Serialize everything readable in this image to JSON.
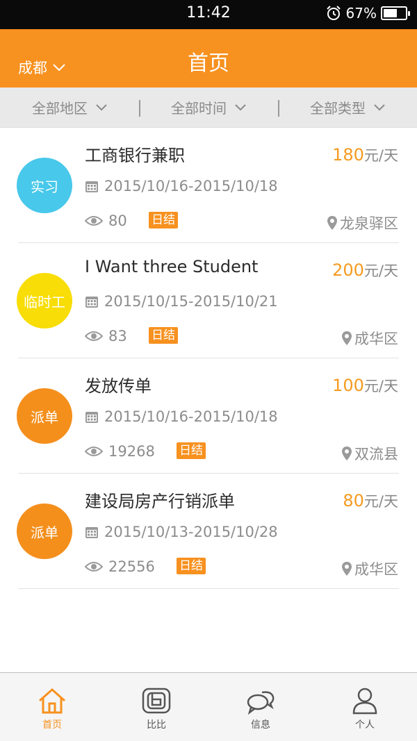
{
  "status": {
    "time": "11:42",
    "battery": "67%",
    "battery_level": 0.67
  },
  "header": {
    "city": "成都",
    "title": "首页"
  },
  "filters": [
    {
      "label": "全部地区"
    },
    {
      "label": "全部时间"
    },
    {
      "label": "全部类型"
    }
  ],
  "jobs": [
    {
      "badge": "实习",
      "badge_color": "#48c8ea",
      "title": "工商银行兼职",
      "price": "180",
      "unit": "元/天",
      "dates": "2015/10/16-2015/10/18",
      "views": "80",
      "tag": "日结",
      "location": "龙泉驿区"
    },
    {
      "badge": "临时工",
      "badge_color": "#f8dd06",
      "title": "I Want three Student",
      "price": "200",
      "unit": "元/天",
      "dates": "2015/10/15-2015/10/21",
      "views": "83",
      "tag": "日结",
      "location": "成华区"
    },
    {
      "badge": "派单",
      "badge_color": "#f48f1c",
      "title": "发放传单",
      "price": "100",
      "unit": "元/天",
      "dates": "2015/10/16-2015/10/18",
      "views": "19268",
      "tag": "日结",
      "location": "双流县"
    },
    {
      "badge": "派单",
      "badge_color": "#f48f1c",
      "title": "建设局房产行销派单",
      "price": "80",
      "unit": "元/天",
      "dates": "2015/10/13-2015/10/28",
      "views": "22556",
      "tag": "日结",
      "location": "成华区"
    }
  ],
  "tabs": [
    {
      "label": "首页",
      "icon": "home-icon",
      "active": true
    },
    {
      "label": "比比",
      "icon": "compare-icon",
      "active": false
    },
    {
      "label": "信息",
      "icon": "chat-icon",
      "active": false
    },
    {
      "label": "个人",
      "icon": "user-icon",
      "active": false
    }
  ],
  "colors": {
    "accent": "#f7911f",
    "price": "#f59a1f"
  }
}
